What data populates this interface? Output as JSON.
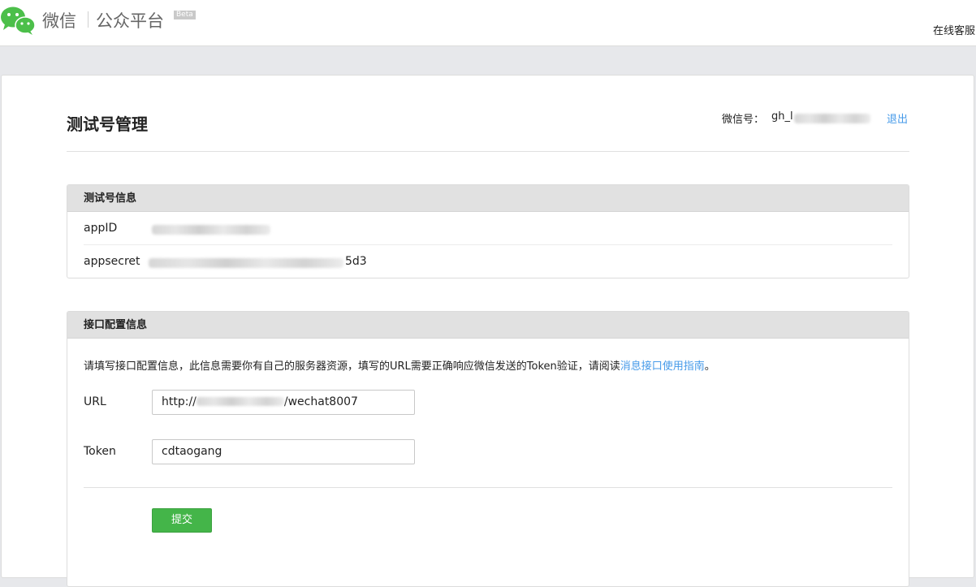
{
  "header": {
    "brand_name": "微信",
    "product_name": "公众平台",
    "beta_label": "Beta",
    "online_service": "在线客服"
  },
  "page": {
    "title": "测试号管理",
    "account_label": "微信号：",
    "account_value_prefix": "gh_l",
    "logout_label": "退出"
  },
  "test_account_panel": {
    "title": "测试号信息",
    "rows": [
      {
        "label": "appID",
        "value_visible": ""
      },
      {
        "label": "appsecret",
        "value_visible": "5d3"
      }
    ]
  },
  "interface_panel": {
    "title": "接口配置信息",
    "notice_text": "请填写接口配置信息，此信息需要你有自己的服务器资源，填写的URL需要正确响应微信发送的Token验证，请阅读",
    "notice_link": "消息接口使用指南",
    "notice_end": "。",
    "url_label": "URL",
    "url_prefix": "http://",
    "url_suffix": "/wechat8007",
    "token_label": "Token",
    "token_value": "cdtaogang",
    "submit_label": "提交"
  },
  "colors": {
    "accent_link": "#459ae9",
    "submit_green": "#44b549",
    "panel_header_bg": "#e1e1e1",
    "page_bg": "#e7e8eb"
  },
  "icons": {
    "logo": "wechat-logo-icon"
  }
}
